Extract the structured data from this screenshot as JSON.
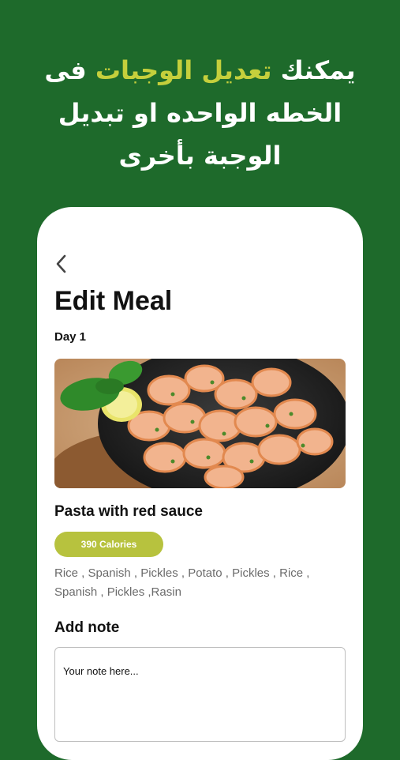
{
  "promo": {
    "line1_before": "يمكنك ",
    "line1_accent": "تعديل الوجبات",
    "line1_after": " فى",
    "line2": "الخطه الواحده او تبديل",
    "line3": "الوجبة بأخرى"
  },
  "screen": {
    "title": "Edit Meal",
    "day": "Day 1",
    "meal": {
      "name": "Pasta with red sauce",
      "calories": "390 Calories",
      "ingredients": "Rice , Spanish , Pickles , Potato , Pickles , Rice , Spanish , Pickles ,Rasin",
      "image": "shrimp-dish-photo"
    },
    "note": {
      "label": "Add note",
      "placeholder": "Your note here..."
    }
  },
  "icons": {
    "back": "chevron-left-icon"
  },
  "colors": {
    "background": "#1e6a2b",
    "accent": "#c5cf3c",
    "calorie_pill": "#b7c23e"
  }
}
